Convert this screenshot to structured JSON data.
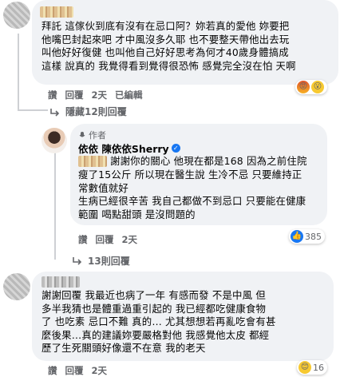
{
  "comment1": {
    "text": "拜託 這傢伙到底有沒有在忌口阿？妳若真的愛他 妳要把\n他嘴巴封起來吧 才中風沒多久耶 也不要整天帶他出去玩\n叫他好好復健 也叫他自己好好思考為何才40歲身體搞成\n這樣 說真的 我覺得看到覺得很恐怖 感覺完全沒在怕 天啊",
    "time": "2天",
    "like": "讚",
    "reply": "回覆",
    "edited": "已編輯"
  },
  "hidden_replies_1": "隱藏12則回覆",
  "author_reply": {
    "tag": "作者",
    "name": "依依 陳依依Sherry",
    "text_line1": "謝謝你的關心 他現在都是168 因為之前住院",
    "text_rest": "瘦了15公斤 所以現在醫生說 生冷不忌 只要維持正\n常數值就好\n生病已經很辛苦 我自己都做不到忌口 只要能在健康\n範圍 喝點甜頭 是沒問題的",
    "like": "讚",
    "reply": "回覆",
    "time": "2天",
    "reaction_count": "385"
  },
  "hidden_replies_2": "13則回覆",
  "comment2": {
    "text": "謝謝回覆 我最近也病了一年 有感而發 不是中風 但\n多半我猜也是體重過重引起的 我已經都吃健康食物\n了 也吃素 忌口不難 真的… 尤其想想若再亂吃會有甚\n麼後果…真的建議妳要嚴格對他 我感覺他太皮 都經\n歷了生死關頭好像還不在意 我的老天",
    "time": "2天",
    "like": "讚",
    "reply": "回覆",
    "reaction_count": "16"
  }
}
